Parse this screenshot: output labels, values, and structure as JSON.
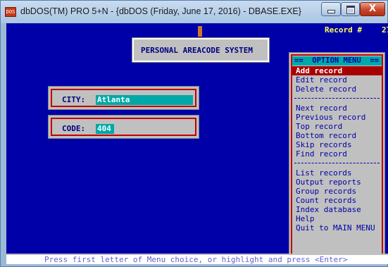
{
  "window": {
    "title": "dbDOS(TM) PRO 5+N - {dbDOS (Friday, June 17, 2016) - DBASE.EXE}",
    "icon": "dbdos-app-icon",
    "icon_text": "DOS",
    "controls": {
      "minimize": "minimize-icon",
      "maximize": "maximize-icon",
      "close": "close-icon",
      "close_glyph": "X"
    }
  },
  "header": {
    "record_label": "Record #",
    "record_number": "27"
  },
  "app": {
    "title": "PERSONAL AREACODE SYSTEM"
  },
  "form": {
    "city": {
      "label": "CITY:",
      "value": "Atlanta"
    },
    "code": {
      "label": "CODE:",
      "value": "404"
    }
  },
  "option_menu": {
    "header": "==  OPTION MENU  ==",
    "items": [
      {
        "label": "Add record",
        "selected": true
      },
      {
        "label": "Edit record"
      },
      {
        "label": "Delete record"
      },
      {
        "label": "Next record"
      },
      {
        "label": "Previous record"
      },
      {
        "label": "Top record"
      },
      {
        "label": "Bottom record"
      },
      {
        "label": "Skip records"
      },
      {
        "label": "Find record"
      },
      {
        "label": "List records"
      },
      {
        "label": "Output reports"
      },
      {
        "label": "Group records"
      },
      {
        "label": "Count records"
      },
      {
        "label": "Index database"
      },
      {
        "label": "Help"
      },
      {
        "label": "Quit to MAIN MENU"
      }
    ]
  },
  "status_bar": {
    "text": "Press first letter of Menu choice, or highlight and press <Enter>"
  },
  "colors": {
    "screen_bg": "#0000a8",
    "panel_bg": "#c0c0c0",
    "frame_red": "#c00000",
    "field_cyan": "#00a8a8",
    "highlight": "#a80000",
    "record_yellow": "#ffff55"
  }
}
